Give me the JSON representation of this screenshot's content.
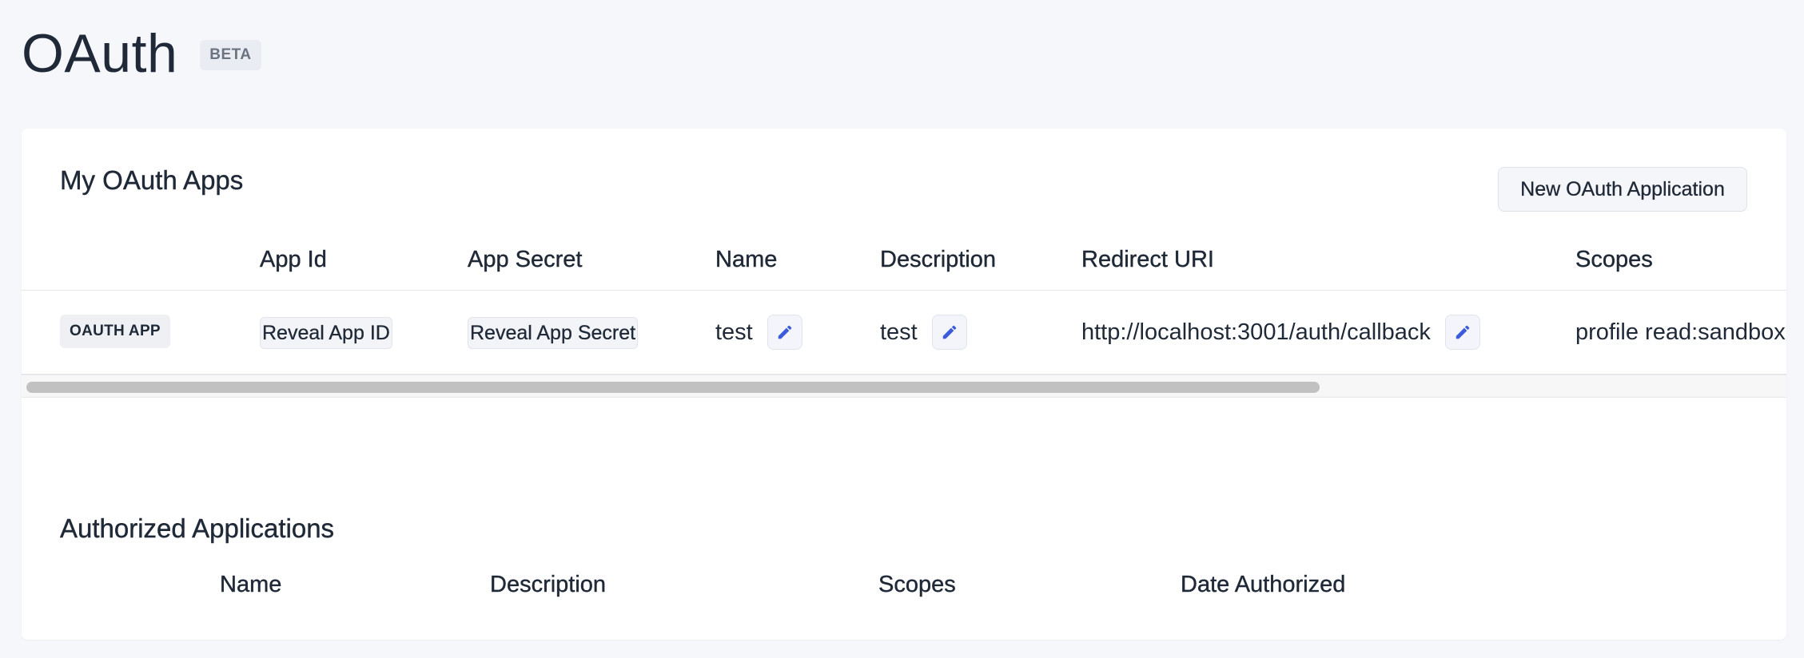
{
  "header": {
    "title": "OAuth",
    "badge": "BETA"
  },
  "my_apps": {
    "title": "My OAuth Apps",
    "new_button_label": "New OAuth Application",
    "columns": [
      "App Id",
      "App Secret",
      "Name",
      "Description",
      "Redirect URI",
      "Scopes"
    ],
    "rows": [
      {
        "tag": "OAUTH APP",
        "app_id_button": "Reveal App ID",
        "app_secret_button": "Reveal App Secret",
        "name": "test",
        "description": "test",
        "redirect_uri": "http://localhost:3001/auth/callback",
        "scopes": "profile read:sandbox"
      }
    ],
    "scrollbar_position": 0
  },
  "authorized": {
    "title": "Authorized Applications",
    "columns": [
      "Name",
      "Description",
      "Scopes",
      "Date Authorized"
    ]
  },
  "colors": {
    "accent": "#3b5bdb",
    "background": "#f6f7fa",
    "card": "#ffffff",
    "text": "#1f2937"
  },
  "icons": {
    "edit": "pencil-icon"
  }
}
